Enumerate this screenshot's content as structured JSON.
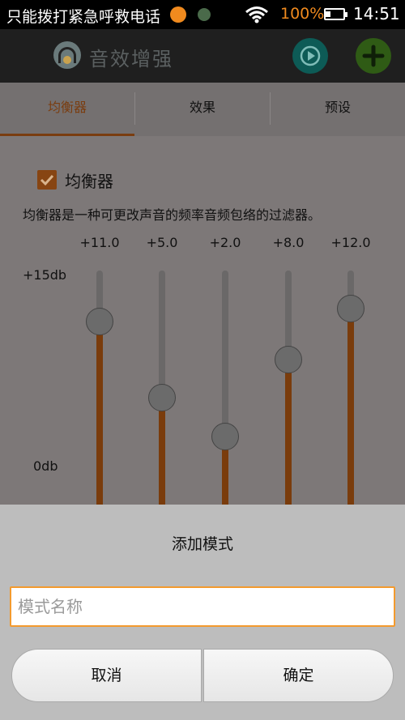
{
  "status_bar": {
    "carrier": "只能拨打紧急呼救电话",
    "battery_pct": "100%",
    "time": "14:51"
  },
  "app_bar": {
    "title": "音效增强",
    "icons": [
      "headphone-logo-icon",
      "play-icon",
      "add-icon"
    ]
  },
  "tabs": [
    {
      "label": "均衡器",
      "active": true
    },
    {
      "label": "效果",
      "active": false
    },
    {
      "label": "预设",
      "active": false
    }
  ],
  "equalizer": {
    "enabled": true,
    "label": "均衡器",
    "description": "均衡器是一种可更改声音的频率音频包络的过滤器。",
    "max_label": "+15db",
    "zero_label": "0db",
    "bands": [
      {
        "value_label": "+11.0",
        "value": 11.0
      },
      {
        "value_label": "+5.0",
        "value": 5.0
      },
      {
        "value_label": "+2.0",
        "value": 2.0
      },
      {
        "value_label": "+8.0",
        "value": 8.0
      },
      {
        "value_label": "+12.0",
        "value": 12.0
      }
    ]
  },
  "dialog": {
    "title": "添加模式",
    "input_placeholder": "模式名称",
    "input_value": "",
    "cancel_label": "取消",
    "ok_label": "确定"
  },
  "colors": {
    "accent": "#f39a2e",
    "eq_fill": "#7a3c0c"
  }
}
